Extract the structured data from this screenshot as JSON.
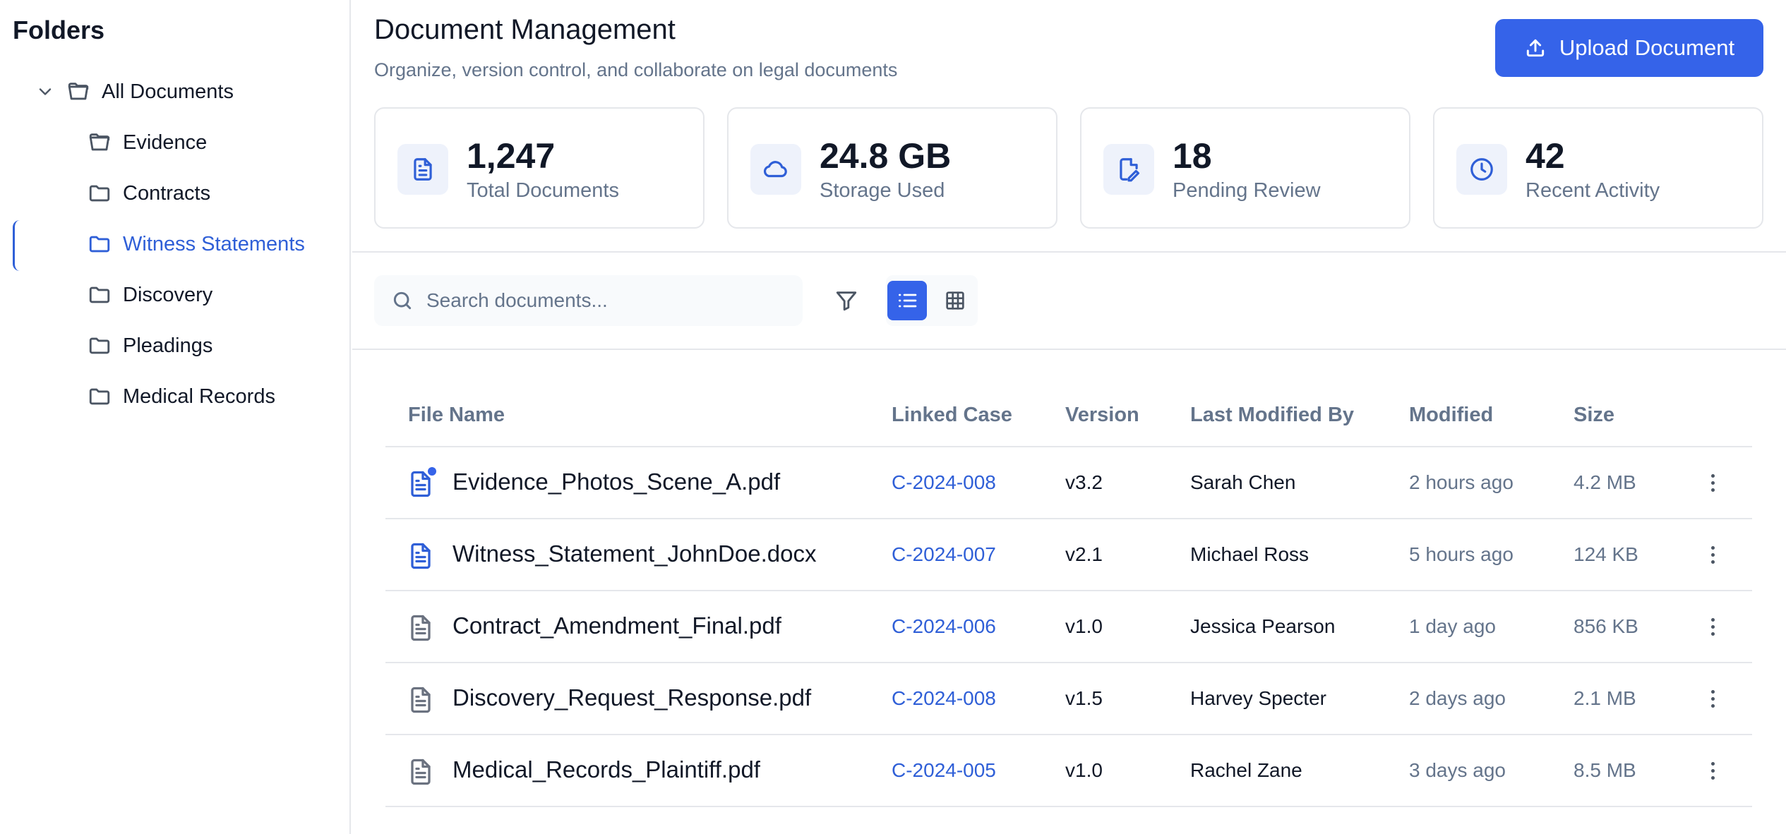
{
  "sidebar": {
    "title": "Folders",
    "root": "All Documents",
    "folders": [
      {
        "label": "Evidence",
        "active": false
      },
      {
        "label": "Contracts",
        "active": false
      },
      {
        "label": "Witness Statements",
        "active": true
      },
      {
        "label": "Discovery",
        "active": false
      },
      {
        "label": "Pleadings",
        "active": false
      },
      {
        "label": "Medical Records",
        "active": false
      }
    ]
  },
  "header": {
    "title": "Document Management",
    "subtitle": "Organize, version control, and collaborate on legal documents",
    "upload_label": "Upload Document"
  },
  "stats": [
    {
      "value": "1,247",
      "label": "Total Documents",
      "icon": "document-icon"
    },
    {
      "value": "24.8 GB",
      "label": "Storage Used",
      "icon": "cloud-icon"
    },
    {
      "value": "18",
      "label": "Pending Review",
      "icon": "file-signature-icon"
    },
    {
      "value": "42",
      "label": "Recent Activity",
      "icon": "clock-icon"
    }
  ],
  "toolbar": {
    "search_placeholder": "Search documents...",
    "view_mode": "list"
  },
  "table": {
    "columns": [
      "File Name",
      "Linked Case",
      "Version",
      "Last Modified By",
      "Modified",
      "Size"
    ],
    "rows": [
      {
        "name": "Evidence_Photos_Scene_A.pdf",
        "case": "C-2024-008",
        "version": "v3.2",
        "by": "Sarah Chen",
        "modified": "2 hours ago",
        "size": "4.2 MB",
        "highlight": true,
        "unread": true
      },
      {
        "name": "Witness_Statement_JohnDoe.docx",
        "case": "C-2024-007",
        "version": "v2.1",
        "by": "Michael Ross",
        "modified": "5 hours ago",
        "size": "124 KB",
        "highlight": true,
        "unread": false
      },
      {
        "name": "Contract_Amendment_Final.pdf",
        "case": "C-2024-006",
        "version": "v1.0",
        "by": "Jessica Pearson",
        "modified": "1 day ago",
        "size": "856 KB",
        "highlight": false,
        "unread": false
      },
      {
        "name": "Discovery_Request_Response.pdf",
        "case": "C-2024-008",
        "version": "v1.5",
        "by": "Harvey Specter",
        "modified": "2 days ago",
        "size": "2.1 MB",
        "highlight": false,
        "unread": false
      },
      {
        "name": "Medical_Records_Plaintiff.pdf",
        "case": "C-2024-005",
        "version": "v1.0",
        "by": "Rachel Zane",
        "modified": "3 days ago",
        "size": "8.5 MB",
        "highlight": false,
        "unread": false
      }
    ]
  },
  "colors": {
    "accent": "#3563e9",
    "link": "#2f5fd7",
    "muted": "#64748b",
    "border": "#e5e7eb"
  }
}
